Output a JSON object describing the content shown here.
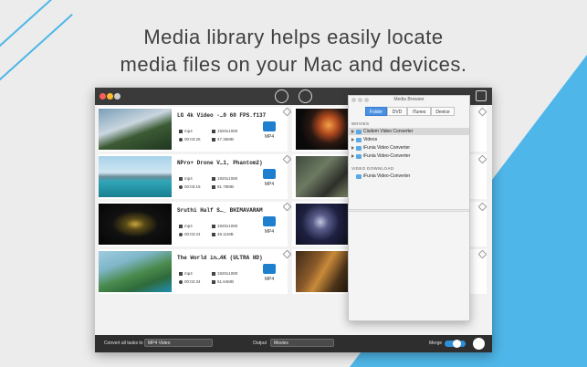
{
  "headline": {
    "line1": "Media library helps easily locate",
    "line2": "media files on your Mac and devices."
  },
  "colors": {
    "accent_blue": "#4eb6e8",
    "badge_blue": "#1f7fcf"
  },
  "window": {
    "toolbar_icons": [
      "convert-mode-icon",
      "dvd-mode-icon",
      "media-browser-icon"
    ],
    "videos": [
      {
        "title": "LG 4k Video -…0 60 FPS.f137",
        "container": "mp4",
        "resolution": "1920x1080",
        "duration": "00:03:26",
        "size": "47.36MB",
        "format": "MP4"
      },
      {
        "title": "NPro+ Drone V…1, Phantom2)",
        "container": "mp4",
        "resolution": "1920x1080",
        "duration": "00:03:15",
        "size": "81.78MB",
        "format": "MP4"
      },
      {
        "title": "Sruthi Half S…_ BHIMAVARAM",
        "container": "mp4",
        "resolution": "1920x1080",
        "duration": "00:03:24",
        "size": "48.11MB",
        "format": "MP4"
      },
      {
        "title": "The World in…4K (ULTRA HD)",
        "container": "mp4",
        "resolution": "1920x1080",
        "duration": "00:02:34",
        "size": "51.64MB",
        "format": "MP4"
      }
    ],
    "bottom": {
      "convert_all_label": "Convert all tasks to",
      "convert_all_value": "MP4 Video",
      "output_label": "Output",
      "output_value": "Movies",
      "merge_label": "Merge"
    }
  },
  "media_browser": {
    "title": "Media Browser",
    "tabs": [
      "Folder",
      "DVD",
      "iTunes",
      "Device"
    ],
    "active_tab": "Folder",
    "movies_header": "MOVIES",
    "movies_items": [
      "Cisdem Video Converter",
      "Videos",
      "iFunia Video Converter",
      "iFunia Video-Converter"
    ],
    "download_header": "VIDEO DOWNLOAD",
    "download_items": [
      "iFunia Video-Converter"
    ]
  }
}
